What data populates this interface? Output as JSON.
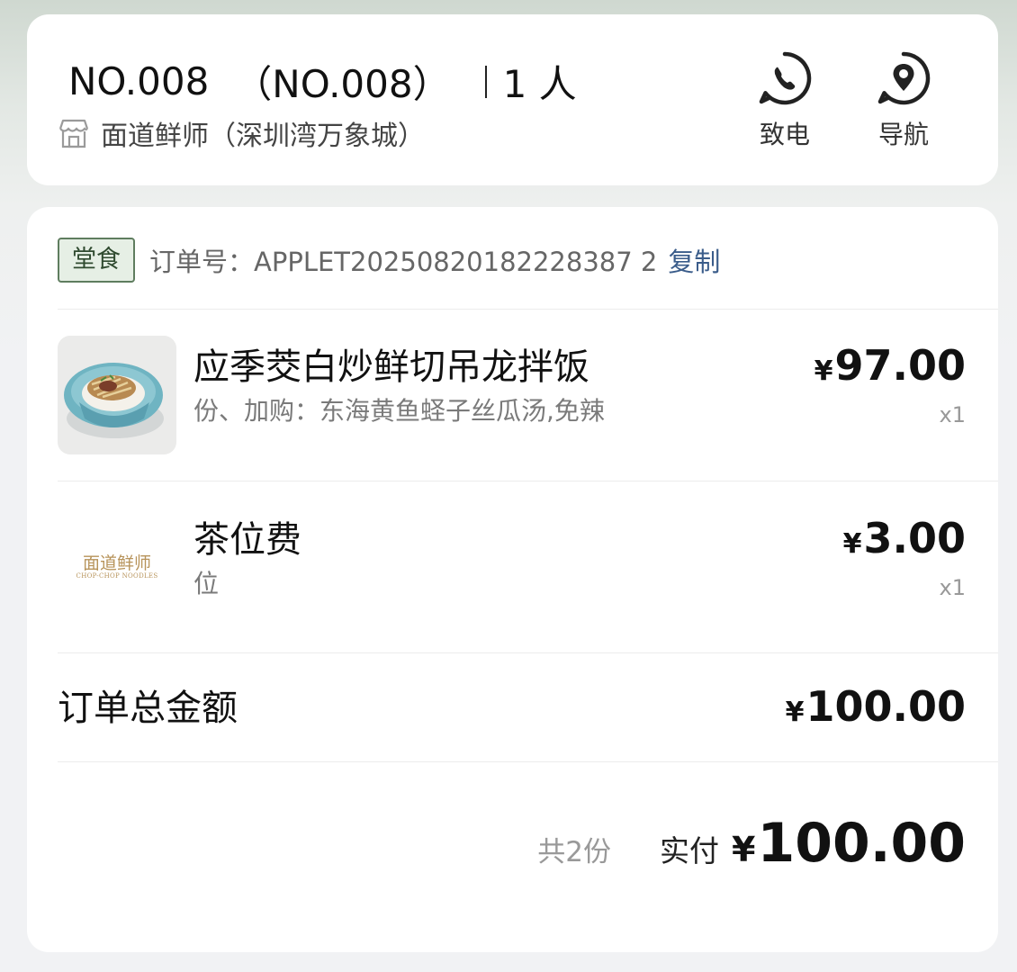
{
  "header": {
    "table_no": "NO.008",
    "table_no_paren": "（NO.008）",
    "guests": "1 人",
    "store_name": "面道鲜师（深圳湾万象城）",
    "actions": {
      "call_label": "致电",
      "navigate_label": "导航"
    }
  },
  "order": {
    "dine_type_tag": "堂食",
    "order_number_label": "订单号：",
    "order_number": "APPLET20250820182228387 2",
    "copy_label": "复制",
    "currency": "¥",
    "items": [
      {
        "name": "应季茭白炒鲜切吊龙拌饭",
        "spec": "份、加购：东海黄鱼蛏子丝瓜汤,免辣",
        "price": "97.00",
        "qty": "x1",
        "thumb_icon": "rice-bowl-dish-photo"
      },
      {
        "name": "茶位费",
        "spec": "位",
        "price": "3.00",
        "qty": "x1",
        "thumb_icon": "brand-logo",
        "logo_text": "面道鲜师",
        "logo_subtext": "CHOP-CHOP NOODLES"
      }
    ],
    "total_label": "订单总金额",
    "total_amount": "100.00",
    "count_text": "共2份",
    "paid_label": "实付",
    "paid_amount": "100.00"
  },
  "colors": {
    "tag_bg": "#e6efe5",
    "tag_border": "#5f7d5f",
    "link": "#3a5c8a"
  }
}
